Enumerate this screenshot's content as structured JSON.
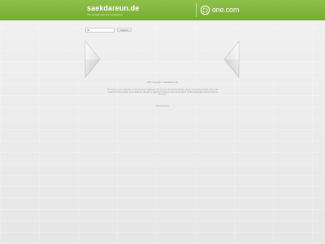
{
  "header": {
    "site_title": "saekdareun.de",
    "site_subtitle": "This domain has been registered",
    "brand_name": "one.com",
    "brand_color": "#76ad33"
  },
  "search": {
    "input_value": "dk",
    "button_label": "Search"
  },
  "nav": {
    "left_icon": "chevron-left-icon",
    "right_icon": "chevron-right-icon"
  },
  "content": {
    "copyright": "2015 Copyright © saekdareun.de",
    "info": "This domain name (saekdareun.de) has been registered with one.com. To use this domain, please contact the domain owner. The registrant of this domain can activate the domain by logging in to the one.com control panel. Further information can be found at one.com.",
    "privacy_link": "Privacy Policy"
  }
}
